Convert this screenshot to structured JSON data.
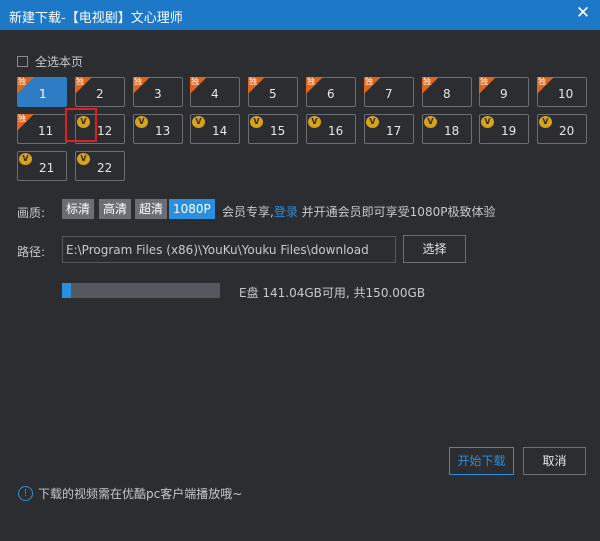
{
  "window": {
    "title": "新建下载-【电视剧】文心理师",
    "close_glyph": "✕"
  },
  "select_all": {
    "label": "全选本页",
    "checked": false
  },
  "badges": {
    "exclusive": "独",
    "vip": "V"
  },
  "episodes": [
    {
      "num": "1",
      "badge": "exclusive",
      "selected": true
    },
    {
      "num": "2",
      "badge": "exclusive"
    },
    {
      "num": "3",
      "badge": "exclusive"
    },
    {
      "num": "4",
      "badge": "exclusive"
    },
    {
      "num": "5",
      "badge": "exclusive"
    },
    {
      "num": "6",
      "badge": "exclusive"
    },
    {
      "num": "7",
      "badge": "exclusive"
    },
    {
      "num": "8",
      "badge": "exclusive"
    },
    {
      "num": "9",
      "badge": "exclusive"
    },
    {
      "num": "10",
      "badge": "exclusive"
    },
    {
      "num": "11",
      "badge": "exclusive"
    },
    {
      "num": "12",
      "badge": "vip"
    },
    {
      "num": "13",
      "badge": "vip"
    },
    {
      "num": "14",
      "badge": "vip"
    },
    {
      "num": "15",
      "badge": "vip"
    },
    {
      "num": "16",
      "badge": "vip"
    },
    {
      "num": "17",
      "badge": "vip"
    },
    {
      "num": "18",
      "badge": "vip"
    },
    {
      "num": "19",
      "badge": "vip"
    },
    {
      "num": "20",
      "badge": "vip"
    },
    {
      "num": "21",
      "badge": "vip"
    },
    {
      "num": "22",
      "badge": "vip"
    }
  ],
  "quality": {
    "label": "画质:",
    "options": [
      "标清",
      "高清",
      "超清",
      "1080P"
    ],
    "active": "1080P",
    "note_prefix": "会员专享,",
    "login_link": "登录",
    "note_suffix": "并开通会员即可享受1080P极致体验"
  },
  "path": {
    "label": "路径:",
    "value": "E:\\Program Files (x86)\\YouKu\\Youku Files\\download",
    "choose_button": "选择"
  },
  "disk": {
    "usage_fraction": 0.06,
    "text": "E盘 141.04GB可用, 共150.00GB"
  },
  "actions": {
    "start": "开始下载",
    "cancel": "取消"
  },
  "tip": {
    "icon": "!",
    "text": "下载的视频需在优酷pc客户端播放哦~"
  },
  "colors": {
    "titlebar": "#1e78c8",
    "accent": "#2b8fe0",
    "exclusive_badge": "#e0641c",
    "vip_badge": "#d9a21b",
    "highlight": "#e02020"
  }
}
